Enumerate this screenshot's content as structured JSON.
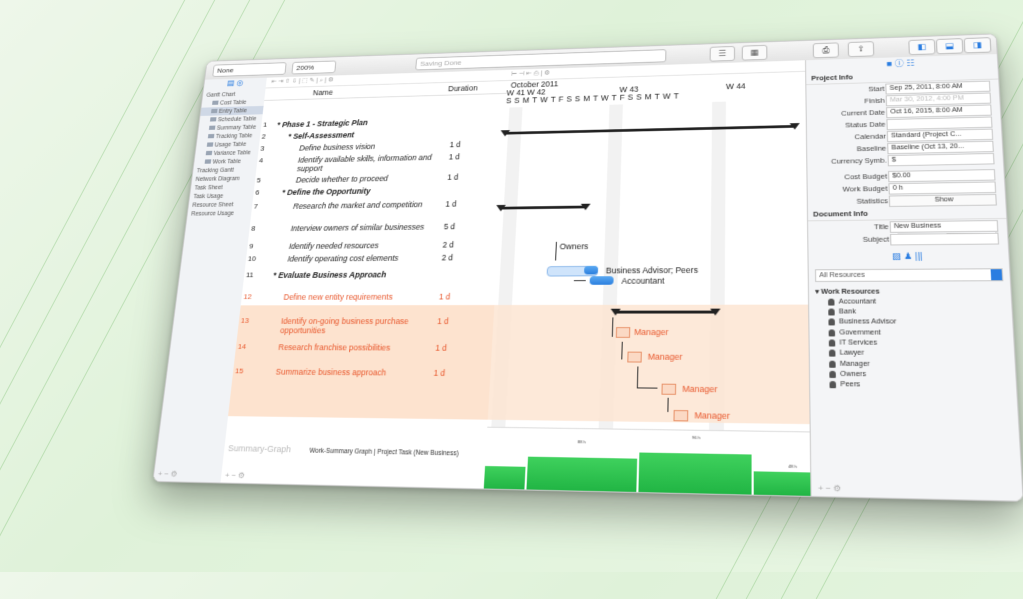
{
  "toolbar": {
    "baseline_select": "None",
    "zoom_select": "200%",
    "status_text": "Saving Done"
  },
  "sidebar": {
    "items": [
      {
        "label": "Gantt Chart",
        "level": 0
      },
      {
        "label": "Cost Table",
        "level": 1
      },
      {
        "label": "Entry Table",
        "level": 1,
        "selected": true
      },
      {
        "label": "Schedule Table",
        "level": 1
      },
      {
        "label": "Summary Table",
        "level": 1
      },
      {
        "label": "Tracking Table",
        "level": 1
      },
      {
        "label": "Usage Table",
        "level": 1
      },
      {
        "label": "Variance Table",
        "level": 1
      },
      {
        "label": "Work Table",
        "level": 1
      },
      {
        "label": "Tracking Gantt",
        "level": 0
      },
      {
        "label": "Network Diagram",
        "level": 0
      },
      {
        "label": "Task Sheet",
        "level": 0
      },
      {
        "label": "Task Usage",
        "level": 0
      },
      {
        "label": "Resource Sheet",
        "level": 0
      },
      {
        "label": "Resource Usage",
        "level": 0
      }
    ]
  },
  "table": {
    "headers": {
      "name": "Name",
      "duration": "Duration"
    },
    "rows": [
      {
        "num": "1",
        "name": "* Phase 1 - Strategic Plan",
        "dur": "",
        "style": "bold",
        "indent": 0
      },
      {
        "num": "2",
        "name": "* Self-Assessment",
        "dur": "",
        "style": "bold",
        "indent": 1
      },
      {
        "num": "3",
        "name": "Define business vision",
        "dur": "1 d",
        "style": "italic",
        "indent": 2
      },
      {
        "num": "4",
        "name": "Identify available skills, information and support",
        "dur": "1 d",
        "style": "italic",
        "indent": 2
      },
      {
        "num": "5",
        "name": "Decide whether to proceed",
        "dur": "1 d",
        "style": "italic",
        "indent": 2
      },
      {
        "num": "6",
        "name": "* Define the Opportunity",
        "dur": "",
        "style": "bold",
        "indent": 1
      },
      {
        "num": "7",
        "name": "Research the market and competition",
        "dur": "1 d",
        "style": "italic",
        "indent": 2
      },
      {
        "num": "8",
        "name": "Interview owners of similar businesses",
        "dur": "5 d",
        "style": "italic",
        "indent": 2
      },
      {
        "num": "9",
        "name": "Identify needed resources",
        "dur": "2 d",
        "style": "italic",
        "indent": 2
      },
      {
        "num": "10",
        "name": "Identify operating cost elements",
        "dur": "2 d",
        "style": "italic",
        "indent": 2
      },
      {
        "num": "11",
        "name": "* Evaluate Business Approach",
        "dur": "",
        "style": "bold",
        "indent": 1
      },
      {
        "num": "12",
        "name": "Define new entity requirements",
        "dur": "1 d",
        "style": "orange",
        "indent": 2
      },
      {
        "num": "13",
        "name": "Identify on-going business purchase opportunities",
        "dur": "1 d",
        "style": "orange",
        "indent": 2
      },
      {
        "num": "14",
        "name": "Research franchise possibilities",
        "dur": "1 d",
        "style": "orange",
        "indent": 2
      },
      {
        "num": "15",
        "name": "Summarize business approach",
        "dur": "1 d",
        "style": "orange",
        "indent": 2
      }
    ],
    "summary_graph_label": "Summary-Graph",
    "summary_graph_caption": "Work-Summary Graph | Project Task (New Business)"
  },
  "gantt": {
    "month": "October 2011",
    "weeks": [
      "W 41",
      "W 42",
      "W 43",
      "W 44"
    ],
    "days": "SSMTWTFSSMTWTFSSMTWT",
    "labels": {
      "owners": "Owners",
      "business_advisor": "Business Advisor; Peers",
      "accountant": "Accountant",
      "manager": "Manager"
    },
    "graph_values": [
      "88 h",
      "96 h",
      "48 h"
    ]
  },
  "inspector": {
    "project_info_title": "Project Info",
    "fields": [
      {
        "label": "Start",
        "value": "Sep 25, 2011, 8:00 AM"
      },
      {
        "label": "Finish",
        "value": "Mar 30, 2012, 4:00 PM",
        "dim": true
      },
      {
        "label": "Current Date",
        "value": "Oct 16, 2015, 8:00 AM"
      },
      {
        "label": "Status Date",
        "value": ""
      },
      {
        "label": "Calendar",
        "value": "Standard (Project C..."
      },
      {
        "label": "Baseline",
        "value": "Baseline (Oct 13, 20..."
      },
      {
        "label": "Currency Symb.",
        "value": "$"
      }
    ],
    "cost_budget_label": "Cost Budget",
    "cost_budget": "$0.00",
    "work_budget_label": "Work Budget",
    "work_budget": "0 h",
    "statistics_label": "Statistics",
    "statistics_button": "Show",
    "document_info_title": "Document Info",
    "doc_title_label": "Title",
    "doc_title": "New Business",
    "doc_subject_label": "Subject",
    "doc_subject": "",
    "resources_dropdown": "All Resources",
    "work_resources_title": "Work Resources",
    "resources": [
      "Accountant",
      "Bank",
      "Business Advisor",
      "Government",
      "IT Services",
      "Lawyer",
      "Manager",
      "Owners",
      "Peers"
    ]
  }
}
